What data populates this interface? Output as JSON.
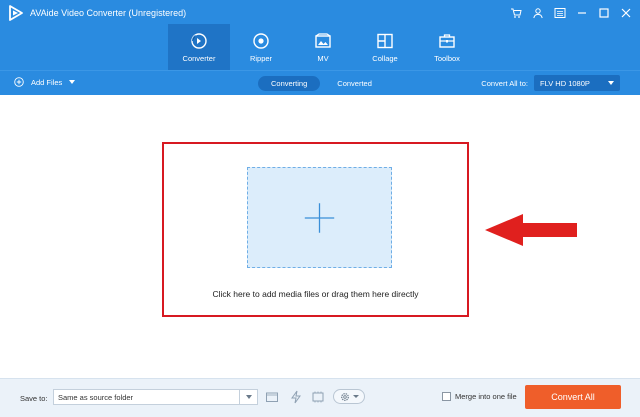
{
  "window": {
    "title": "AVAide Video Converter (Unregistered)",
    "controls": [
      "cart-icon",
      "account-icon",
      "menu-icon",
      "minimize-icon",
      "maximize-icon",
      "close-icon"
    ]
  },
  "nav": {
    "tabs": [
      {
        "label": "Converter",
        "icon": "converter-icon",
        "active": true
      },
      {
        "label": "Ripper",
        "icon": "ripper-icon",
        "active": false
      },
      {
        "label": "MV",
        "icon": "mv-icon",
        "active": false
      },
      {
        "label": "Collage",
        "icon": "collage-icon",
        "active": false
      },
      {
        "label": "Toolbox",
        "icon": "toolbox-icon",
        "active": false
      }
    ]
  },
  "toolbar": {
    "add_files_label": "Add Files",
    "segments": [
      {
        "label": "Converting",
        "active": true
      },
      {
        "label": "Converted",
        "active": false
      }
    ],
    "convert_all_label": "Convert All to:",
    "format_value": "FLV HD 1080P"
  },
  "main": {
    "drop_text": "Click here to add media files or drag them here directly"
  },
  "footer": {
    "save_to_label": "Save to:",
    "save_to_value": "Same as source folder",
    "merge_label": "Merge into one file",
    "merge_checked": false,
    "convert_button_label": "Convert All"
  },
  "colors": {
    "header_blue": "#2a8be0",
    "active_tab": "#1f74c6",
    "highlight_red": "#d71921",
    "drop_zone": "#dcedfb",
    "convert_orange": "#ef5e2a"
  }
}
